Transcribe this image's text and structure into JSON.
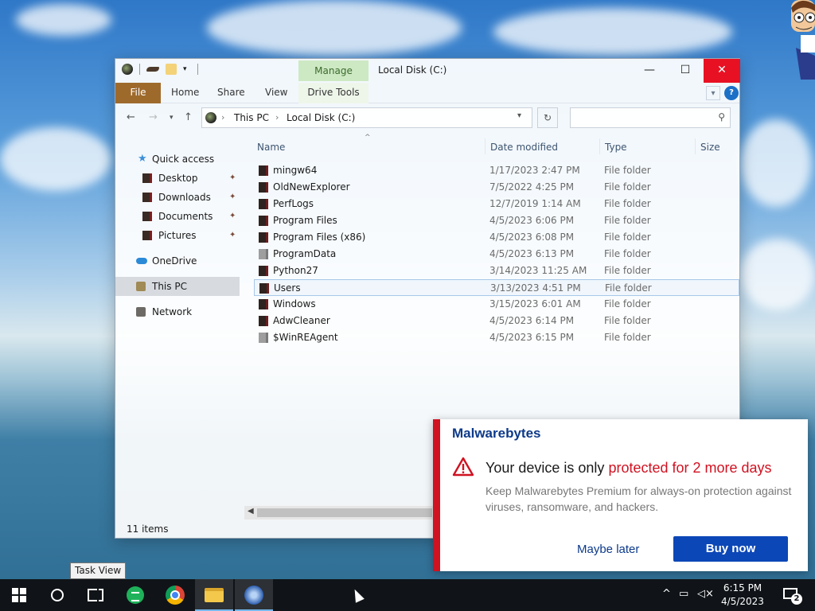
{
  "explorer": {
    "title": "Local Disk (C:)",
    "manage_tab": "Manage",
    "ribbon_tabs": {
      "file": "File",
      "home": "Home",
      "share": "Share",
      "view": "View",
      "drive_tools": "Drive Tools"
    },
    "window_controls": {
      "minimize": "—",
      "maximize": "☐",
      "close": "✕"
    },
    "address": {
      "crumbs": [
        "This PC",
        "Local Disk (C:)"
      ]
    },
    "search_placeholder": "",
    "nav": {
      "quick_access": "Quick access",
      "desktop": "Desktop",
      "downloads": "Downloads",
      "documents": "Documents",
      "pictures": "Pictures",
      "onedrive": "OneDrive",
      "this_pc": "This PC",
      "network": "Network"
    },
    "columns": {
      "name": "Name",
      "date": "Date modified",
      "type": "Type",
      "size": "Size"
    },
    "files": [
      {
        "name": "mingw64",
        "date": "1/17/2023 2:47 PM",
        "type": "File folder"
      },
      {
        "name": "OldNewExplorer",
        "date": "7/5/2022 4:25 PM",
        "type": "File folder"
      },
      {
        "name": "PerfLogs",
        "date": "12/7/2019 1:14 AM",
        "type": "File folder"
      },
      {
        "name": "Program Files",
        "date": "4/5/2023 6:06 PM",
        "type": "File folder"
      },
      {
        "name": "Program Files (x86)",
        "date": "4/5/2023 6:08 PM",
        "type": "File folder"
      },
      {
        "name": "ProgramData",
        "date": "4/5/2023 6:13 PM",
        "type": "File folder"
      },
      {
        "name": "Python27",
        "date": "3/14/2023 11:25 AM",
        "type": "File folder"
      },
      {
        "name": "Users",
        "date": "3/13/2023 4:51 PM",
        "type": "File folder"
      },
      {
        "name": "Windows",
        "date": "3/15/2023 6:01 AM",
        "type": "File folder"
      },
      {
        "name": "AdwCleaner",
        "date": "4/5/2023 6:14 PM",
        "type": "File folder"
      },
      {
        "name": "$WinREAgent",
        "date": "4/5/2023 6:15 PM",
        "type": "File folder"
      }
    ],
    "status": "11 items"
  },
  "toast": {
    "brand": "Malwarebytes",
    "headline_prefix": "Your device is only ",
    "headline_highlight": "protected for 2 more days",
    "body": "Keep Malwarebytes Premium for always-on protection against viruses, ransomware, and hackers.",
    "later_label": "Maybe later",
    "buy_label": "Buy now",
    "accent_color": "#d01221",
    "button_color": "#0c47b7"
  },
  "taskbar": {
    "tooltip": "Task View",
    "time": "6:15 PM",
    "date": "4/5/2023",
    "notification_count": "2"
  }
}
